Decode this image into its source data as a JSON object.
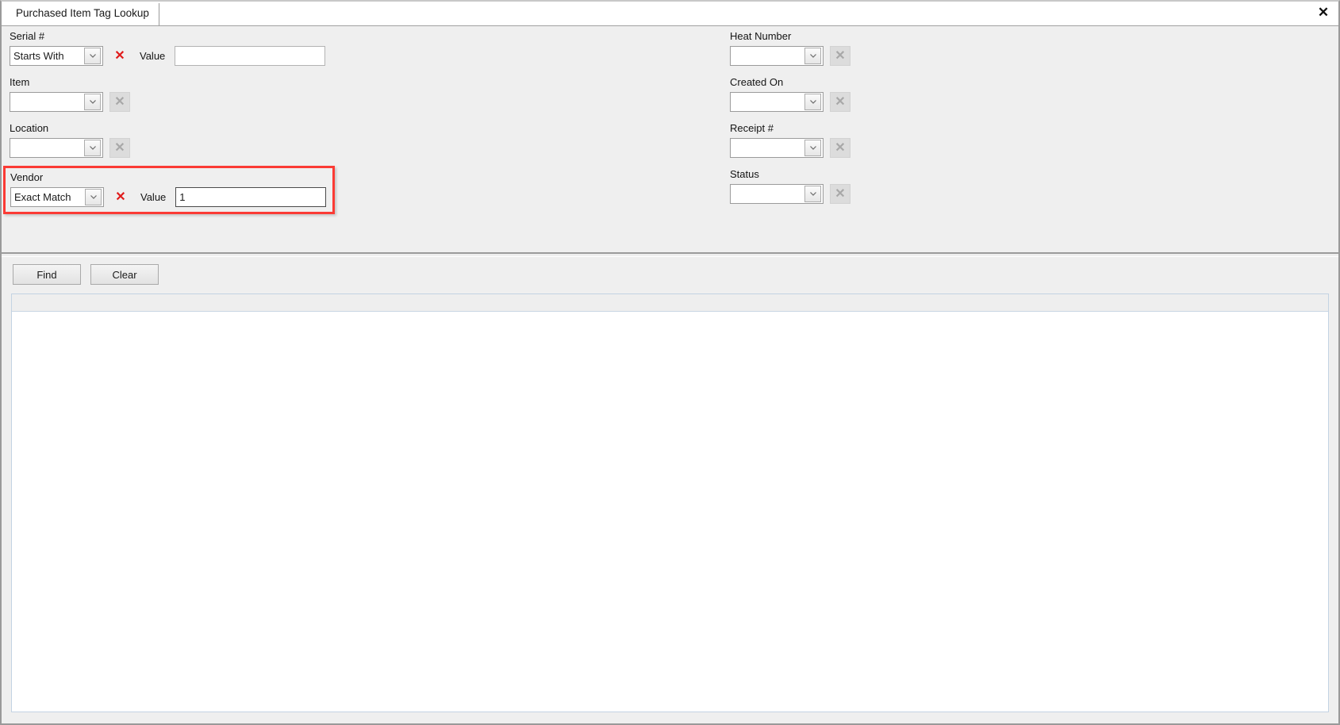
{
  "window": {
    "close_icon": "close-icon",
    "close_glyph": "✕"
  },
  "tabs": [
    {
      "label": "Purchased Item Tag Lookup",
      "active": true
    }
  ],
  "criteria": {
    "left_column": [
      {
        "name": "serial",
        "label": "Serial #",
        "control": "operator-combo",
        "operator": "Starts With",
        "clear_enabled": true,
        "value_label": "Value",
        "value": "",
        "value_placeholder": "",
        "highlighted": false
      },
      {
        "name": "item",
        "label": "Item",
        "control": "lookup-combo",
        "operator": "",
        "clear_enabled": false,
        "value_label": "",
        "value": "",
        "value_placeholder": "",
        "highlighted": false
      },
      {
        "name": "location",
        "label": "Location",
        "control": "lookup-combo",
        "operator": "",
        "clear_enabled": false,
        "value_label": "",
        "value": "",
        "value_placeholder": "",
        "highlighted": false
      },
      {
        "name": "vendor",
        "label": "Vendor",
        "control": "operator-combo",
        "operator": "Exact Match",
        "clear_enabled": true,
        "value_label": "Value",
        "value": "1",
        "value_placeholder": "",
        "highlighted": true
      }
    ],
    "right_column": [
      {
        "name": "heat-number",
        "label": "Heat Number",
        "control": "lookup-combo",
        "operator": "",
        "clear_enabled": false
      },
      {
        "name": "created-on",
        "label": "Created On",
        "control": "lookup-combo",
        "operator": "",
        "clear_enabled": false
      },
      {
        "name": "receipt-number",
        "label": "Receipt #",
        "control": "lookup-combo",
        "operator": "",
        "clear_enabled": false
      },
      {
        "name": "status",
        "label": "Status",
        "control": "lookup-combo",
        "operator": "",
        "clear_enabled": false
      }
    ]
  },
  "actions": {
    "find_label": "Find",
    "clear_label": "Clear"
  },
  "results": {
    "columns": [],
    "rows": [],
    "row_count": 0
  },
  "colors": {
    "highlight": "#fb3b35",
    "clear_enabled": "#e01b1b",
    "clear_disabled": "#a8a8a8",
    "panel_bg": "#efefef",
    "grid_bg": "#ffffff",
    "grid_border": "#c3d3e3"
  },
  "icons": {
    "chevron_down": "chevron-down-icon",
    "clear_x": "clear-x-icon"
  }
}
